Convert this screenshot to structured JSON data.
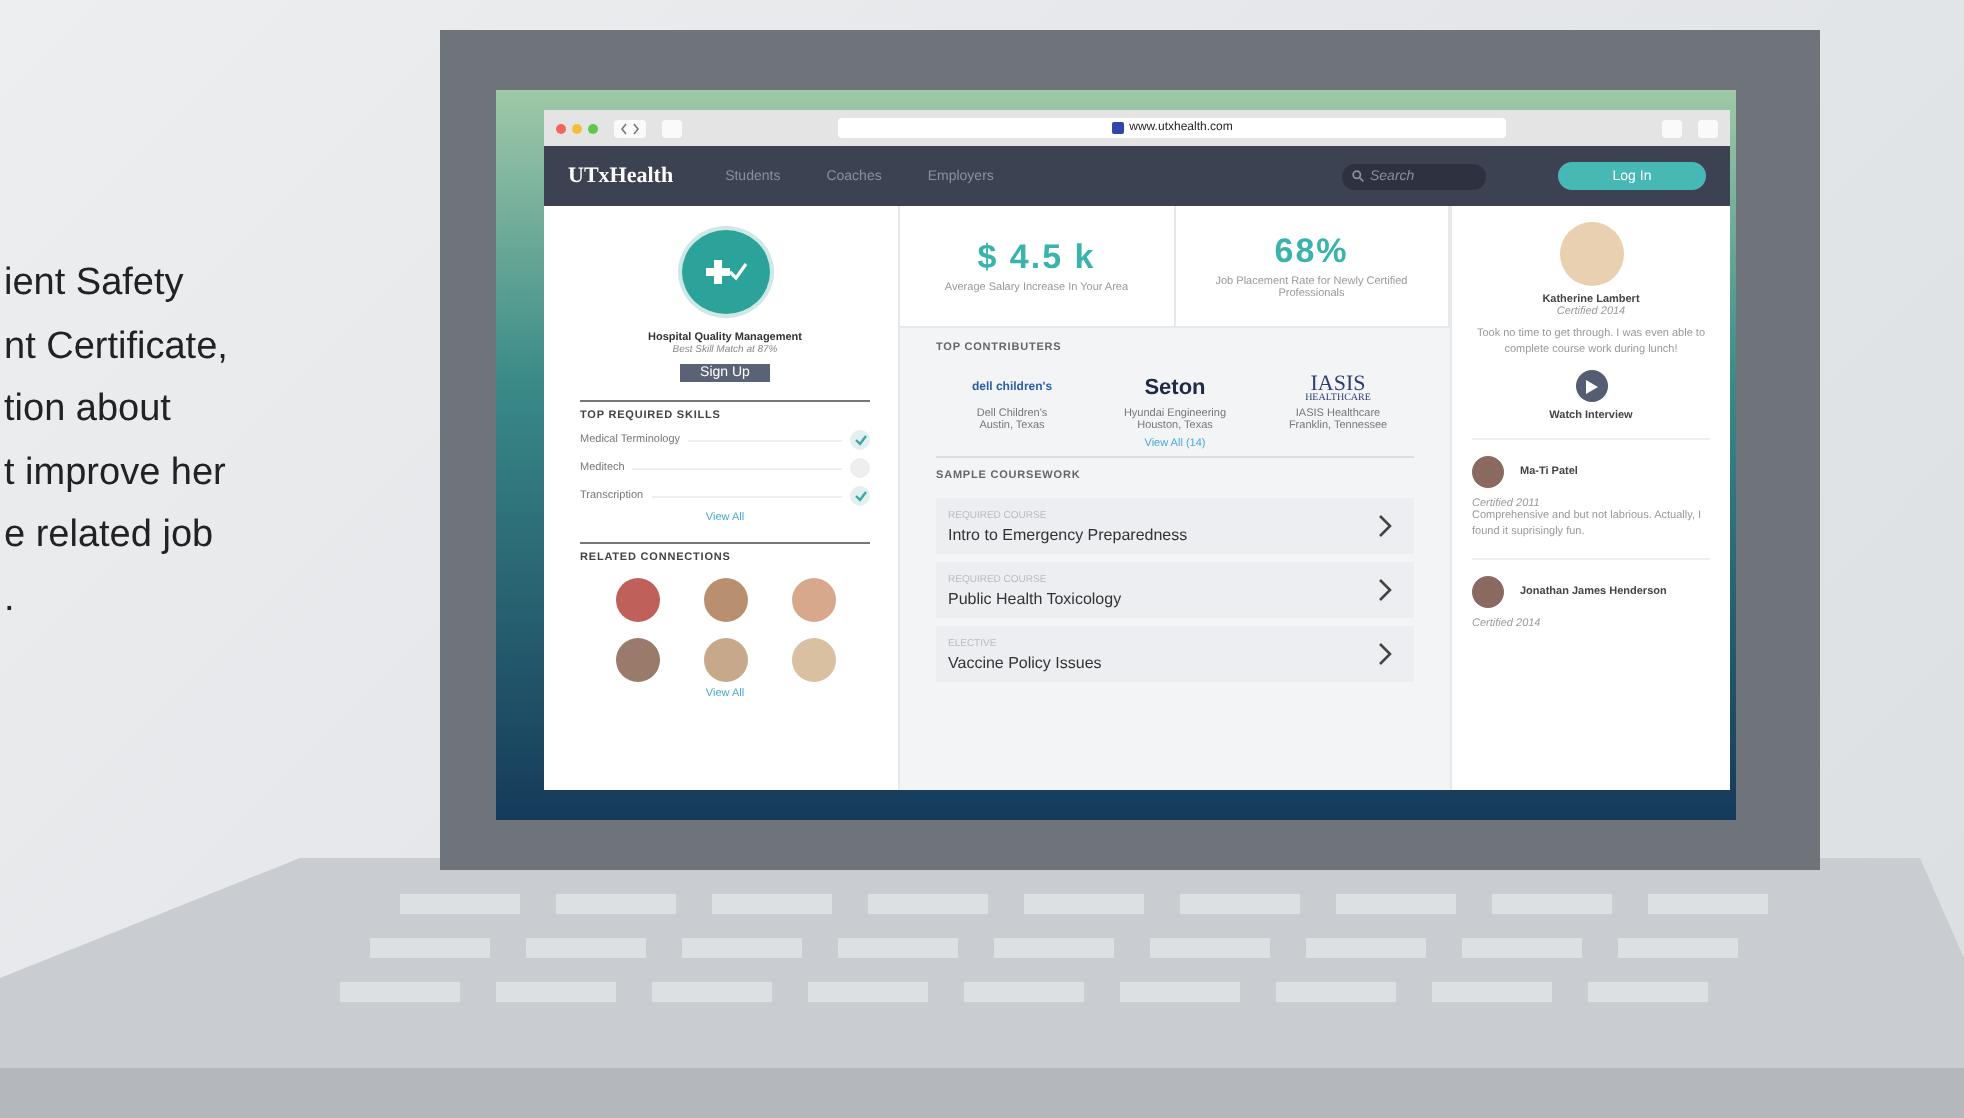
{
  "slide_text": [
    "ient Safety",
    "nt Certificate,",
    "tion about",
    "t improve her",
    "e related job",
    "."
  ],
  "browser": {
    "url": "www.utxhealth.com"
  },
  "nav": {
    "brand": "UTxHealth",
    "links": [
      "Students",
      "Coaches",
      "Employers"
    ],
    "search": {
      "placeholder": "Search"
    },
    "login": "Log In"
  },
  "left_panel": {
    "title": "Hospital Quality Management",
    "subtitle": "Best Skill Match at 87%",
    "signup": "Sign Up",
    "skills_heading": "TOP REQUIRED SKILLS",
    "skills": [
      {
        "name": "Medical Terminology",
        "checked": true
      },
      {
        "name": "Meditech",
        "checked": false
      },
      {
        "name": "Transcription",
        "checked": true
      }
    ],
    "skills_view_all": "View All",
    "connections_heading": "RELATED CONNECTIONS",
    "connections_view_all": "View All"
  },
  "stats": [
    {
      "value": "$ 4.5 k",
      "label": "Average Salary Increase In Your Area"
    },
    {
      "value": "68%",
      "label": "Job Placement Rate for Newly Certified Professionals"
    }
  ],
  "contributors": {
    "heading": "TOP CONTRIBUTERS",
    "items": [
      {
        "kind": "dell",
        "logo": "dell children's",
        "name": "Dell Children's",
        "location": "Austin, Texas"
      },
      {
        "kind": "seton",
        "logo": "Seton",
        "name": "Hyundai Engineering",
        "location": "Houston, Texas"
      },
      {
        "kind": "iasis",
        "logo": "IASIS",
        "logo_sub": "HEALTHCARE",
        "name": "IASIS Healthcare",
        "location": "Franklin, Tennessee"
      }
    ],
    "view_all": "View All (14)"
  },
  "coursework": {
    "heading": "SAMPLE COURSEWORK",
    "items": [
      {
        "type": "REQUIRED COURSE",
        "title": "Intro to Emergency Preparedness"
      },
      {
        "type": "REQUIRED COURSE",
        "title": "Public Health Toxicology"
      },
      {
        "type": "ELECTIVE",
        "title": "Vaccine Policy Issues"
      }
    ]
  },
  "featured_testimonial": {
    "name": "Katherine Lambert",
    "certified": "Certified 2014",
    "quote": "Took no time to get through. I was even able to complete course work during lunch!",
    "action": "Watch Interview"
  },
  "testimonials": [
    {
      "name": "Ma-Ti Patel",
      "certified": "Certified 2011",
      "text": "Comprehensive and but not labrious. Actually, I found it suprisingly fun."
    },
    {
      "name": "Jonathan James Henderson",
      "certified": "Certified 2014"
    }
  ]
}
